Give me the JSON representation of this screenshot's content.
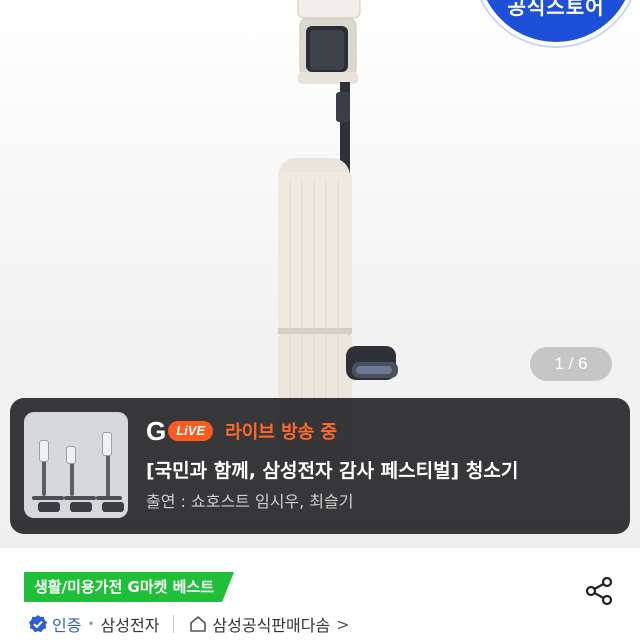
{
  "hero": {
    "badge_text": "공식스토어",
    "image_counter": "1 / 6"
  },
  "live": {
    "g_logo": "G",
    "live_label": "LiVE",
    "status": "라이브 방송 중",
    "title": "[국민과 함께, 삼성전자 감사 페스티벌] 청소기",
    "cast": "출연 : 쇼호스트 임시우, 최슬기"
  },
  "product": {
    "best_tag": "생활/미용가전 G마켓 베스트",
    "certified": "인증",
    "brand": "삼성전자",
    "store": "삼성공식판매다솜",
    "store_chevron": ">"
  },
  "colors": {
    "live_orange": "#ff5a1f",
    "best_green": "#1fbf3a",
    "cert_blue": "#2f5bd6",
    "badge_blue": "#1e4fd9"
  },
  "icons": [
    "share-icon",
    "check-badge-icon",
    "home-icon",
    "chevron-right-icon"
  ]
}
